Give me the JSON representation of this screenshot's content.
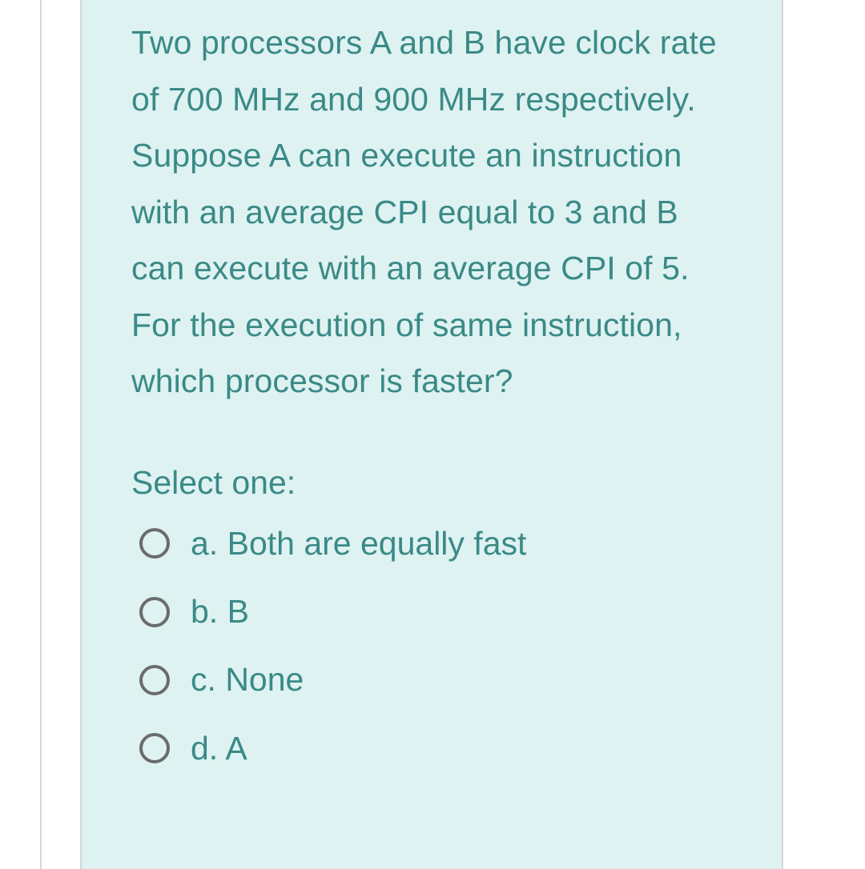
{
  "question": {
    "text": "Two processors A and B have clock rate of 700 MHz and 900 MHz respectively. Suppose A can execute an instruction with an average CPI equal to 3 and B can execute with an average CPI of 5. For the execution of same instruction, which processor is faster?",
    "prompt": "Select one:",
    "options": [
      {
        "letter": "a.",
        "text": "Both are equally fast"
      },
      {
        "letter": "b.",
        "text": "B"
      },
      {
        "letter": "c.",
        "text": "None"
      },
      {
        "letter": "d.",
        "text": "A"
      }
    ]
  }
}
